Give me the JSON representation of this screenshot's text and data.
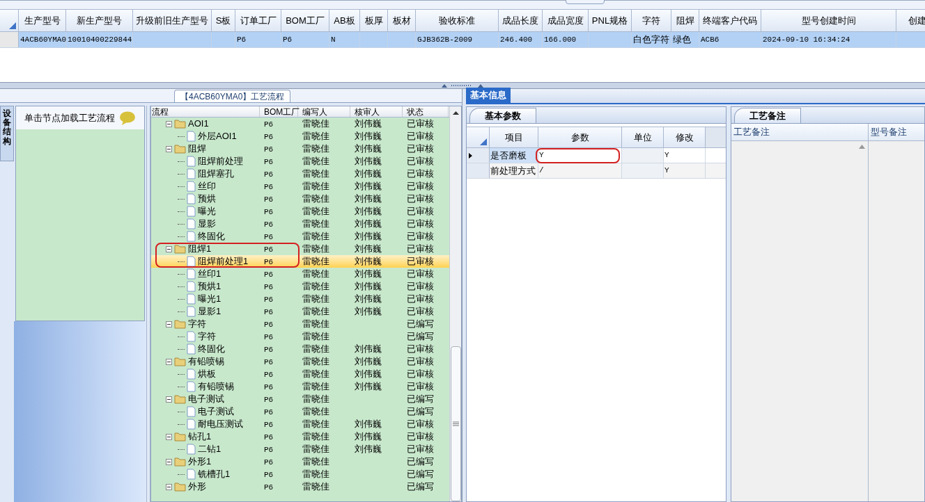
{
  "main_table": {
    "columns": [
      "生产型号",
      "新生产型号",
      "升级前旧生产型号",
      "S板",
      "订单工厂",
      "BOM工厂",
      "AB板",
      "板厚",
      "板材",
      "验收标准",
      "成品长度",
      "成品宽度",
      "PNL规格",
      "字符",
      "阻焊",
      "终端客户代码",
      "型号创建时间",
      "创建"
    ],
    "rows": [
      {
        "selected": true,
        "cells": [
          "4ACB60YMA0",
          "10010400229844",
          null,
          null,
          "P6",
          "P6",
          "N",
          null,
          null,
          "GJB362B-2009",
          "246.400",
          "166.000",
          null,
          "白色字符",
          "绿色",
          "ACB6",
          "2024-09-10 16:34:24",
          null
        ]
      }
    ]
  },
  "process_panel": {
    "title": "【4ACB60YMA0】工艺流程",
    "side_tab": "设备结构",
    "hint": "单击节点加载工艺流程"
  },
  "tree": {
    "columns": [
      "流程",
      "BOM工厂",
      "编写人",
      "核审人",
      "状态"
    ],
    "rows": [
      {
        "kind": "folder",
        "label": "AOI1",
        "bom": "P6",
        "writer": "雷晓佳",
        "reviewer": "刘伟巍",
        "status": "已审核",
        "expanded": true,
        "selected": false,
        "children": [
          {
            "kind": "file",
            "label": "外层AOI1",
            "bom": "P6",
            "writer": "雷晓佳",
            "reviewer": "刘伟巍",
            "status": "已审核",
            "selected": false
          }
        ]
      },
      {
        "kind": "folder",
        "label": "阻焊",
        "bom": "P6",
        "writer": "雷晓佳",
        "reviewer": "刘伟巍",
        "status": "已审核",
        "expanded": true,
        "selected": false,
        "children": [
          {
            "kind": "file",
            "label": "阻焊前处理",
            "bom": "P6",
            "writer": "雷晓佳",
            "reviewer": "刘伟巍",
            "status": "已审核",
            "selected": false
          },
          {
            "kind": "file",
            "label": "阻焊塞孔",
            "bom": "P6",
            "writer": "雷晓佳",
            "reviewer": "刘伟巍",
            "status": "已审核",
            "selected": false
          },
          {
            "kind": "file",
            "label": "丝印",
            "bom": "P6",
            "writer": "雷晓佳",
            "reviewer": "刘伟巍",
            "status": "已审核",
            "selected": false
          },
          {
            "kind": "file",
            "label": "预烘",
            "bom": "P6",
            "writer": "雷晓佳",
            "reviewer": "刘伟巍",
            "status": "已审核",
            "selected": false
          },
          {
            "kind": "file",
            "label": "曝光",
            "bom": "P6",
            "writer": "雷晓佳",
            "reviewer": "刘伟巍",
            "status": "已审核",
            "selected": false
          },
          {
            "kind": "file",
            "label": "显影",
            "bom": "P6",
            "writer": "雷晓佳",
            "reviewer": "刘伟巍",
            "status": "已审核",
            "selected": false
          },
          {
            "kind": "file",
            "label": "终固化",
            "bom": "P6",
            "writer": "雷晓佳",
            "reviewer": "刘伟巍",
            "status": "已审核",
            "selected": false
          }
        ]
      },
      {
        "kind": "folder",
        "label": "阻焊1",
        "bom": "P6",
        "writer": "雷晓佳",
        "reviewer": "刘伟巍",
        "status": "已审核",
        "expanded": true,
        "selected": false,
        "children": [
          {
            "kind": "file",
            "label": "阻焊前处理1",
            "bom": "P6",
            "writer": "雷晓佳",
            "reviewer": "刘伟巍",
            "status": "已审核",
            "selected": true
          },
          {
            "kind": "file",
            "label": "丝印1",
            "bom": "P6",
            "writer": "雷晓佳",
            "reviewer": "刘伟巍",
            "status": "已审核",
            "selected": false
          },
          {
            "kind": "file",
            "label": "预烘1",
            "bom": "P6",
            "writer": "雷晓佳",
            "reviewer": "刘伟巍",
            "status": "已审核",
            "selected": false
          },
          {
            "kind": "file",
            "label": "曝光1",
            "bom": "P6",
            "writer": "雷晓佳",
            "reviewer": "刘伟巍",
            "status": "已审核",
            "selected": false
          },
          {
            "kind": "file",
            "label": "显影1",
            "bom": "P6",
            "writer": "雷晓佳",
            "reviewer": "刘伟巍",
            "status": "已审核",
            "selected": false
          }
        ]
      },
      {
        "kind": "folder",
        "label": "字符",
        "bom": "P6",
        "writer": "雷晓佳",
        "status": "已编写",
        "expanded": true,
        "selected": false,
        "children": [
          {
            "kind": "file",
            "label": "字符",
            "bom": "P6",
            "writer": "雷晓佳",
            "status": "已编写",
            "selected": false
          },
          {
            "kind": "file",
            "label": "终固化",
            "bom": "P6",
            "writer": "雷晓佳",
            "reviewer": "刘伟巍",
            "status": "已审核",
            "selected": false
          }
        ]
      },
      {
        "kind": "folder",
        "label": "有铅喷锡",
        "bom": "P6",
        "writer": "雷晓佳",
        "reviewer": "刘伟巍",
        "status": "已审核",
        "expanded": true,
        "selected": false,
        "children": [
          {
            "kind": "file",
            "label": "烘板",
            "bom": "P6",
            "writer": "雷晓佳",
            "reviewer": "刘伟巍",
            "status": "已审核",
            "selected": false
          },
          {
            "kind": "file",
            "label": "有铅喷锡",
            "bom": "P6",
            "writer": "雷晓佳",
            "reviewer": "刘伟巍",
            "status": "已审核",
            "selected": false
          }
        ]
      },
      {
        "kind": "folder",
        "label": "电子测试",
        "bom": "P6",
        "writer": "雷晓佳",
        "status": "已编写",
        "expanded": true,
        "selected": false,
        "children": [
          {
            "kind": "file",
            "label": "电子测试",
            "bom": "P6",
            "writer": "雷晓佳",
            "status": "已编写",
            "selected": false
          },
          {
            "kind": "file",
            "label": "耐电压测试",
            "bom": "P6",
            "writer": "雷晓佳",
            "reviewer": "刘伟巍",
            "status": "已审核",
            "selected": false
          }
        ]
      },
      {
        "kind": "folder",
        "label": "钻孔1",
        "bom": "P6",
        "writer": "雷晓佳",
        "reviewer": "刘伟巍",
        "status": "已审核",
        "expanded": true,
        "selected": false,
        "children": [
          {
            "kind": "file",
            "label": "二钻1",
            "bom": "P6",
            "writer": "雷晓佳",
            "reviewer": "刘伟巍",
            "status": "已审核",
            "selected": false
          }
        ]
      },
      {
        "kind": "folder",
        "label": "外形1",
        "bom": "P6",
        "writer": "雷晓佳",
        "status": "已编写",
        "expanded": true,
        "selected": false,
        "children": [
          {
            "kind": "file",
            "label": "铣槽孔1",
            "bom": "P6",
            "writer": "雷晓佳",
            "status": "已编写",
            "selected": false
          }
        ]
      },
      {
        "kind": "folder",
        "label": "外形",
        "bom": "P6",
        "writer": "雷晓佳",
        "status": "已编写",
        "expanded": true,
        "selected": false
      }
    ]
  },
  "info_tab": {
    "label": "基本信息",
    "selected": true
  },
  "params": {
    "tab": "基本参数",
    "columns": [
      "项目",
      "参数",
      "单位",
      "修改"
    ],
    "rows": [
      {
        "selected": true,
        "cells": [
          "是否磨板",
          "Y",
          null,
          "Y"
        ]
      },
      {
        "selected": false,
        "cells": [
          "前处理方式",
          "/",
          null,
          "Y"
        ]
      }
    ]
  },
  "notes": {
    "tab": "工艺备注",
    "columns": [
      "工艺备注",
      "型号备注"
    ]
  }
}
